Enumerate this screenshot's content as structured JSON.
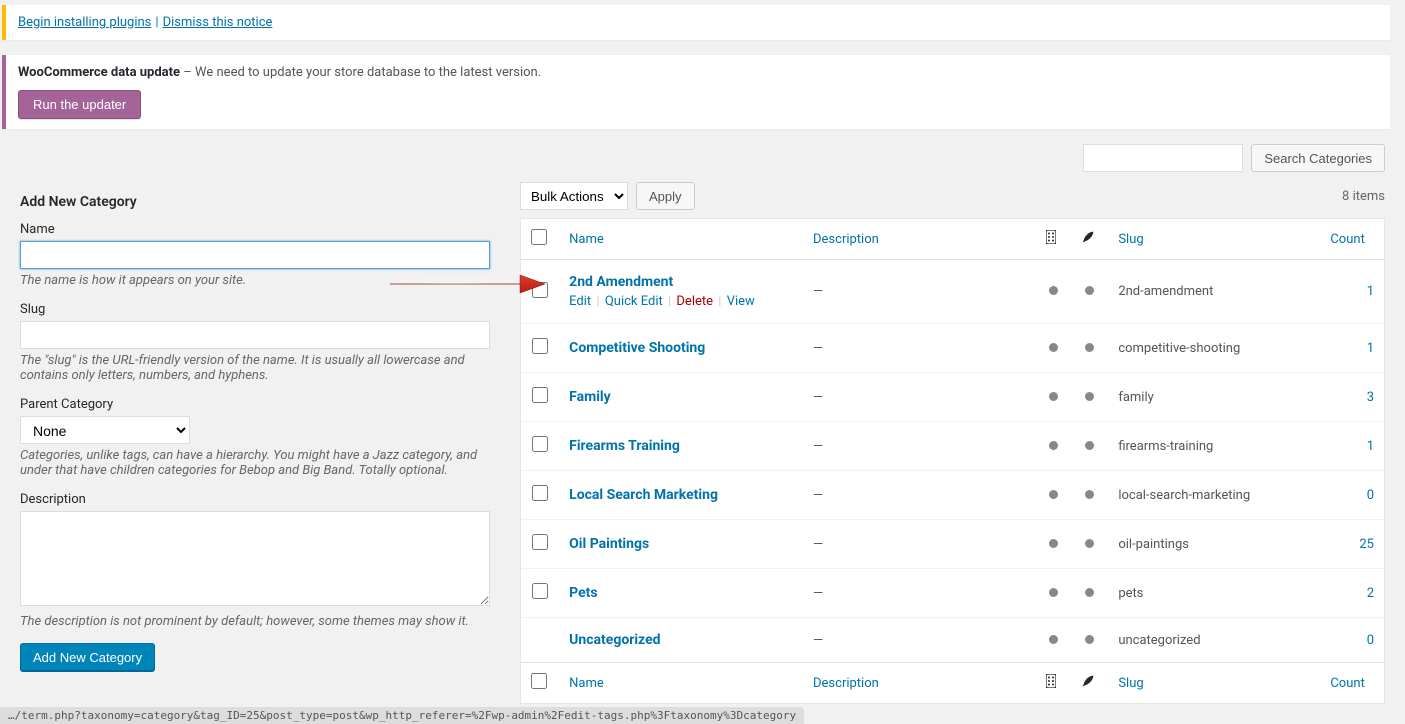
{
  "notices": {
    "plugins": {
      "begin": "Begin installing plugins",
      "dismiss": "Dismiss this notice"
    },
    "woo": {
      "title": "WooCommerce data update",
      "text": " – We need to update your store database to the latest version.",
      "button": "Run the updater"
    }
  },
  "search": {
    "button": "Search Categories"
  },
  "form": {
    "heading": "Add New Category",
    "name": {
      "label": "Name",
      "desc": "The name is how it appears on your site."
    },
    "slug": {
      "label": "Slug",
      "desc": "The \"slug\" is the URL-friendly version of the name. It is usually all lowercase and contains only letters, numbers, and hyphens."
    },
    "parent": {
      "label": "Parent Category",
      "option": "None",
      "desc": "Categories, unlike tags, can have a hierarchy. You might have a Jazz category, and under that have children categories for Bebop and Big Band. Totally optional."
    },
    "description": {
      "label": "Description",
      "desc": "The description is not prominent by default; however, some themes may show it."
    },
    "submit": "Add New Category"
  },
  "table": {
    "bulk": {
      "option": "Bulk Actions",
      "apply": "Apply"
    },
    "count": "8 items",
    "headers": {
      "name": "Name",
      "description": "Description",
      "slug": "Slug",
      "count": "Count"
    },
    "row_actions": {
      "edit": "Edit",
      "quick": "Quick Edit",
      "delete": "Delete",
      "view": "View"
    },
    "rows": [
      {
        "name": "2nd Amendment",
        "desc": "—",
        "slug": "2nd-amendment",
        "count": "1",
        "actions": true,
        "cb": true
      },
      {
        "name": "Competitive Shooting",
        "desc": "—",
        "slug": "competitive-shooting",
        "count": "1",
        "cb": true
      },
      {
        "name": "Family",
        "desc": "—",
        "slug": "family",
        "count": "3",
        "cb": true
      },
      {
        "name": "Firearms Training",
        "desc": "—",
        "slug": "firearms-training",
        "count": "1",
        "cb": true
      },
      {
        "name": "Local Search Marketing",
        "desc": "—",
        "slug": "local-search-marketing",
        "count": "0",
        "cb": true
      },
      {
        "name": "Oil Paintings",
        "desc": "—",
        "slug": "oil-paintings",
        "count": "25",
        "cb": true
      },
      {
        "name": "Pets",
        "desc": "—",
        "slug": "pets",
        "count": "2",
        "cb": true
      },
      {
        "name": "Uncategorized",
        "desc": "—",
        "slug": "uncategorized",
        "count": "0",
        "cb": false
      }
    ]
  },
  "status_url": "…/term.php?taxonomy=category&tag_ID=25&post_type=post&wp_http_referer=%2Fwp-admin%2Fedit-tags.php%3Ftaxonomy%3Dcategory"
}
